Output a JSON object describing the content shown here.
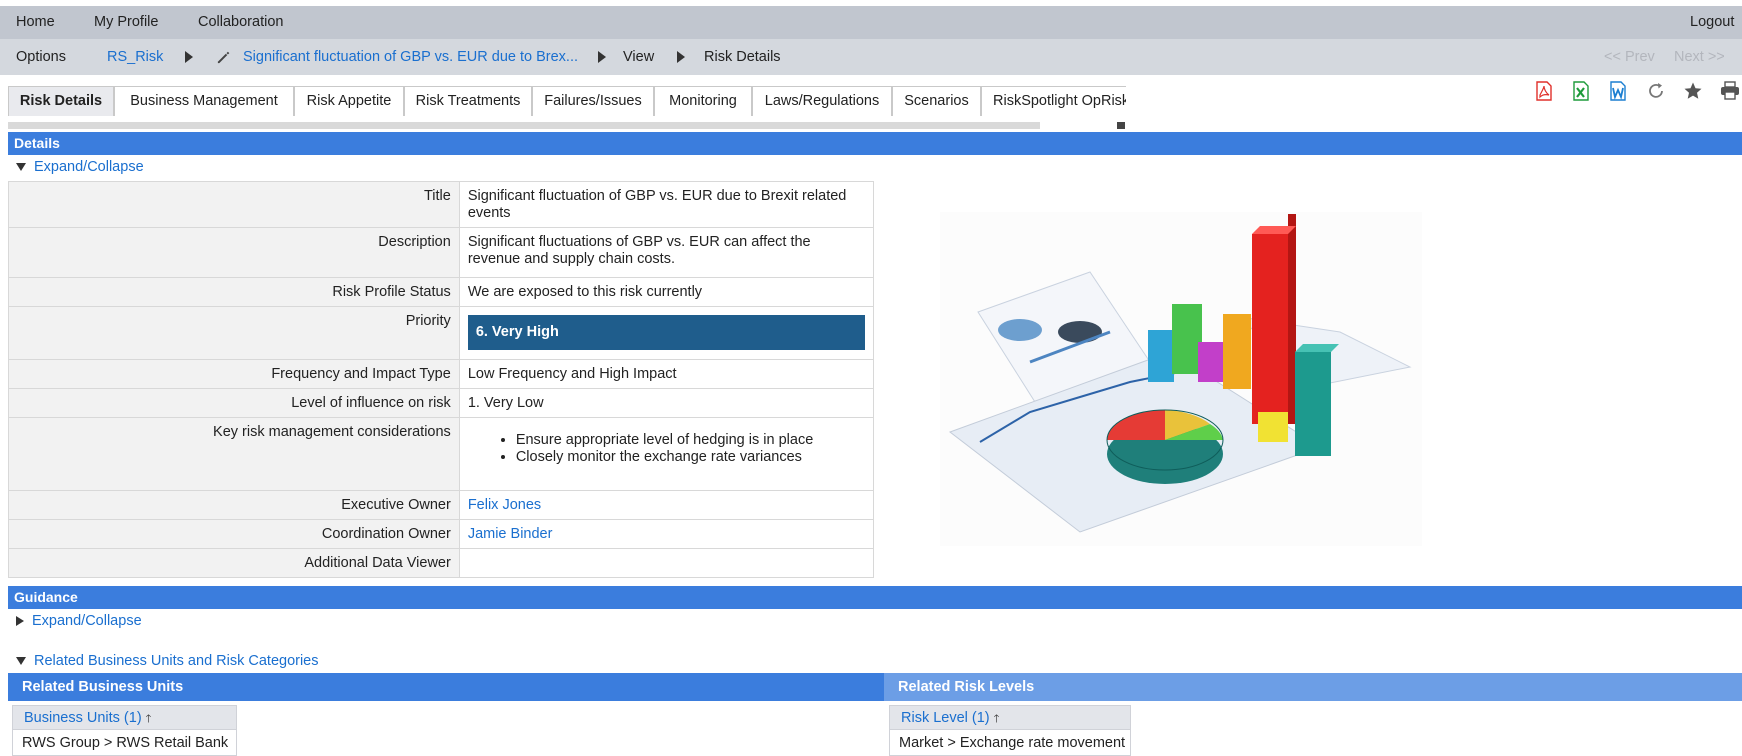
{
  "topnav": {
    "home": "Home",
    "profile": "My Profile",
    "collaboration": "Collaboration",
    "logout": "Logout"
  },
  "breadcrumb": {
    "options": "Options",
    "module": "RS_Risk",
    "record": "Significant fluctuation of GBP vs. EUR due to Brex...",
    "view": "View",
    "page": "Risk Details",
    "prev": "<< Prev",
    "next": "Next >>"
  },
  "tabs": [
    "Risk Details",
    "Business Management",
    "Risk Appetite",
    "Risk Treatments",
    "Failures/Issues",
    "Monitoring",
    "Laws/Regulations",
    "Scenarios",
    "RiskSpotlight OpRisk L"
  ],
  "toolbar_icons": [
    "pdf-icon",
    "excel-icon",
    "word-icon",
    "refresh-icon",
    "star-icon",
    "print-icon"
  ],
  "details": {
    "header": "Details",
    "toggle": "Expand/Collapse",
    "title_label": "Title",
    "title_value": "Significant fluctuation of GBP vs. EUR due to Brexit related events",
    "description_label": "Description",
    "description_value": "Significant fluctuations of GBP vs. EUR can affect the revenue and supply chain costs.",
    "status_label": "Risk Profile Status",
    "status_value": "We are exposed to this risk currently",
    "priority_label": "Priority",
    "priority_value": "6. Very High",
    "freq_label": "Frequency and Impact Type",
    "freq_value": "Low Frequency and High Impact",
    "influence_label": "Level of influence on risk",
    "influence_value": "1. Very Low",
    "considerations_label": "Key risk management considerations",
    "considerations": [
      "Ensure appropriate level of hedging is in place",
      "Closely monitor the exchange rate variances"
    ],
    "exec_owner_label": "Executive Owner",
    "exec_owner_value": "Felix Jones",
    "coord_owner_label": "Coordination Owner",
    "coord_owner_value": "Jamie Binder",
    "viewer_label": "Additional Data Viewer",
    "viewer_value": ""
  },
  "guidance": {
    "header": "Guidance",
    "toggle": "Expand/Collapse"
  },
  "related": {
    "toggle": "Related Business Units and Risk Categories",
    "units_header": "Related Business Units",
    "units_sub": "Business Units (1)",
    "units_rows": [
      "RWS Group > RWS Retail Bank"
    ],
    "levels_header": "Related Risk Levels",
    "levels_sub": "Risk Level (1)",
    "levels_rows": [
      "Market > Exchange rate movement"
    ]
  },
  "colors": {
    "section_blue": "#3b7ddd",
    "related_levels_blue": "#6c9ee6",
    "priority_bg": "#1f5d8c",
    "link": "#1a6fcf"
  }
}
